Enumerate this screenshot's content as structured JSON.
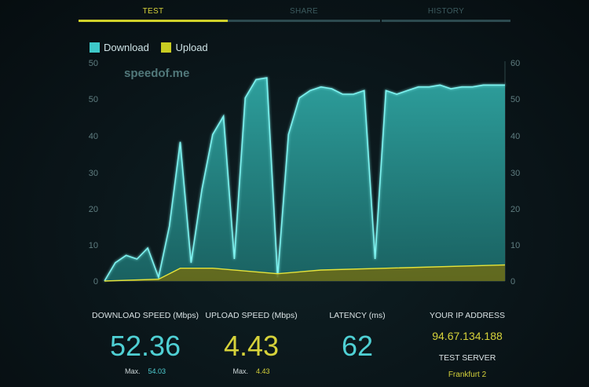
{
  "tabs": [
    {
      "label": "TEST",
      "active": true
    },
    {
      "label": "SHARE",
      "active": false
    },
    {
      "label": "HISTORY",
      "active": false
    }
  ],
  "legend": {
    "download_label": "Download",
    "upload_label": "Upload",
    "download_color": "#3ec9c9",
    "upload_color": "#c9cc22"
  },
  "brand": "speedof.me",
  "chart_data": {
    "type": "area",
    "y_left_ticks": [
      0,
      10,
      20,
      30,
      40,
      50
    ],
    "y_right_ticks": [
      0,
      10,
      20,
      30,
      40,
      50,
      60
    ],
    "ylim_left": [
      0,
      60
    ],
    "ylim_right": [
      0,
      60
    ],
    "series": [
      {
        "name": "Download",
        "color": "#3ec9c9",
        "points": [
          [
            0,
            0
          ],
          [
            1,
            5
          ],
          [
            2,
            7
          ],
          [
            3,
            6
          ],
          [
            4,
            9
          ],
          [
            5,
            1
          ],
          [
            6,
            15
          ],
          [
            7,
            38
          ],
          [
            8,
            5
          ],
          [
            9,
            25
          ],
          [
            10,
            40
          ],
          [
            11,
            45
          ],
          [
            12,
            6
          ],
          [
            13,
            50
          ],
          [
            14,
            55
          ],
          [
            15,
            55.5
          ],
          [
            16,
            1
          ],
          [
            17,
            40
          ],
          [
            18,
            50
          ],
          [
            19,
            52
          ],
          [
            20,
            53
          ],
          [
            21,
            52.5
          ],
          [
            22,
            51
          ],
          [
            23,
            51
          ],
          [
            24,
            52
          ],
          [
            25,
            6
          ],
          [
            26,
            52
          ],
          [
            27,
            51
          ],
          [
            28,
            52
          ],
          [
            29,
            53
          ],
          [
            30,
            53
          ],
          [
            31,
            53.5
          ],
          [
            32,
            52.5
          ],
          [
            33,
            53
          ],
          [
            34,
            53
          ],
          [
            35,
            53.5
          ],
          [
            36,
            53.5
          ],
          [
            37,
            53.5
          ]
        ]
      },
      {
        "name": "Upload",
        "color": "#c9cc22",
        "points": [
          [
            0,
            0
          ],
          [
            5,
            0.5
          ],
          [
            6,
            2
          ],
          [
            7,
            3.5
          ],
          [
            10,
            3.5
          ],
          [
            16,
            2
          ],
          [
            20,
            3
          ],
          [
            37,
            4.4
          ]
        ]
      }
    ]
  },
  "stats": {
    "download_label": "DOWNLOAD SPEED (Mbps)",
    "download_value": "52.36",
    "download_max_label": "Max.",
    "download_max_value": "54.03",
    "upload_label": "UPLOAD SPEED (Mbps)",
    "upload_value": "4.43",
    "upload_max_label": "Max.",
    "upload_max_value": "4.43",
    "latency_label": "LATENCY (ms)",
    "latency_value": "62",
    "ip_label": "YOUR IP ADDRESS",
    "ip_value": "94.67.134.188",
    "server_label": "TEST SERVER",
    "server_value": "Frankfurt 2"
  }
}
